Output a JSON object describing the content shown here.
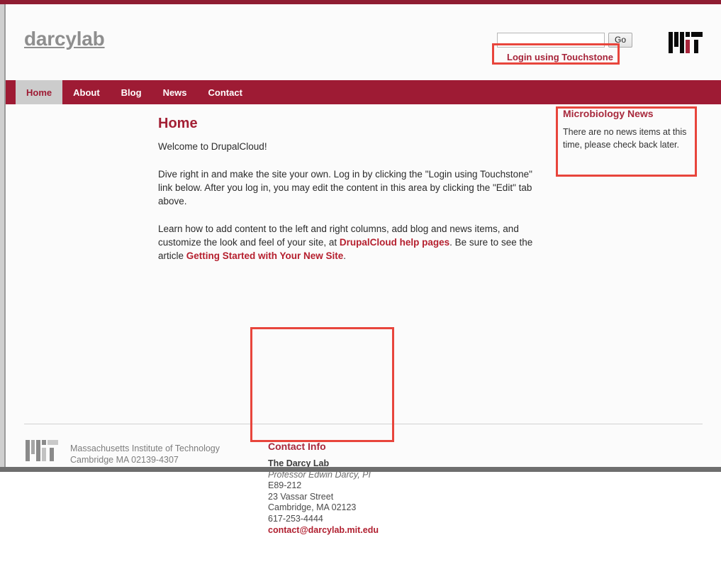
{
  "site": {
    "title": "darcylab",
    "brand_color": "#9e1b34",
    "accent_color": "#a31f34",
    "highlight_color": "#e8453c"
  },
  "header": {
    "search": {
      "value": "",
      "placeholder": "",
      "go_label": "Go"
    },
    "touchstone_link": "Login using Touchstone",
    "mit_logo_alt": "MIT"
  },
  "nav": {
    "items": [
      {
        "label": "Home",
        "active": true
      },
      {
        "label": "About",
        "active": false
      },
      {
        "label": "Blog",
        "active": false
      },
      {
        "label": "News",
        "active": false
      },
      {
        "label": "Contact",
        "active": false
      }
    ]
  },
  "main": {
    "page_title": "Home",
    "para1": "Welcome to DrupalCloud!",
    "para2_a": "Dive right in and make the site your own. Log in by clicking the \"Login using Touchstone\" link below. After you log in, you may edit the content in this area by clicking the \"Edit\" tab above.",
    "para3_a": "Learn how to add content to the left and right columns, add blog and news items, and customize the look and feel of your site, at ",
    "para3_link1": "DrupalCloud help pages",
    "para3_b": ". Be sure to see the article ",
    "para3_link2": "Getting Started with Your New Site",
    "para3_c": "."
  },
  "sidebar": {
    "news_title": "Microbiology News",
    "news_text": "There are no news items at this time, please check back later."
  },
  "footer": {
    "mit_logo_alt": "MIT",
    "org_line1": "Massachusetts Institute of Technology",
    "org_line2": "Cambridge MA 02139-4307",
    "contact": {
      "title": "Contact Info",
      "lab_name": "The Darcy Lab",
      "pi_name": "Professor Edwin Darcy, PI",
      "room": "E89-212",
      "street": "23 Vassar Street",
      "city": "Cambridge, MA 02123",
      "phone": "617-253-4444",
      "email": "contact@darcylab.mit.edu"
    }
  }
}
